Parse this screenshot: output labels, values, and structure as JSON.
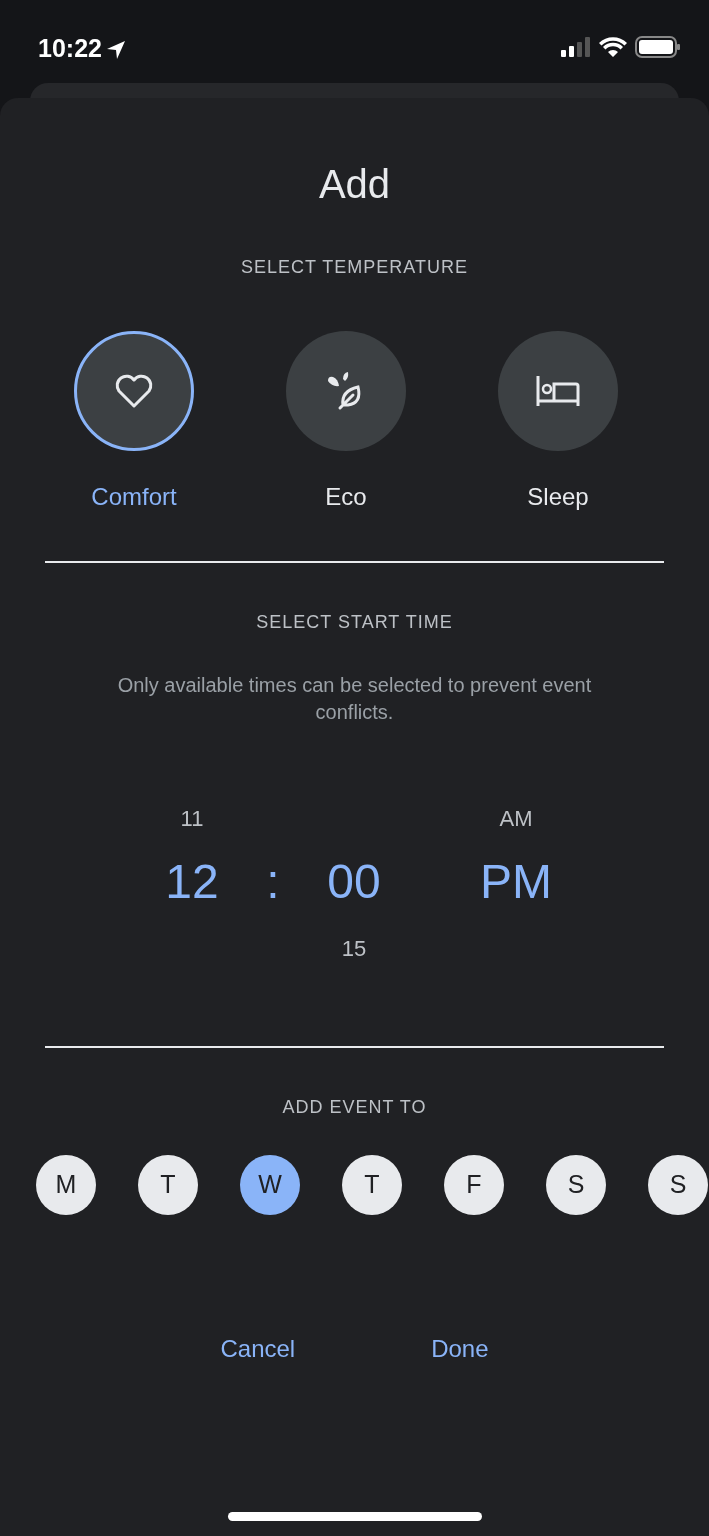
{
  "status_bar": {
    "time": "10:22"
  },
  "title": "Add",
  "temperature": {
    "heading": "SELECT TEMPERATURE",
    "options": [
      {
        "kind": "heart",
        "label": "Comfort",
        "selected": true
      },
      {
        "kind": "leaf",
        "label": "Eco",
        "selected": false
      },
      {
        "kind": "bed",
        "label": "Sleep",
        "selected": false
      }
    ]
  },
  "start_time": {
    "heading": "SELECT START TIME",
    "note": "Only available times can be selected to prevent event conflicts.",
    "columns": [
      {
        "kind": "hour",
        "above": "11",
        "value": "12"
      },
      {
        "kind": "separator",
        "value": ":"
      },
      {
        "kind": "minute",
        "value": "00",
        "below": "15"
      },
      {
        "kind": "period",
        "above": "AM",
        "value": "PM"
      }
    ]
  },
  "days": {
    "heading": "ADD EVENT TO",
    "items": [
      {
        "label": "M",
        "selected": false
      },
      {
        "label": "T",
        "selected": false
      },
      {
        "label": "W",
        "selected": true
      },
      {
        "label": "T",
        "selected": false
      },
      {
        "label": "F",
        "selected": false
      },
      {
        "label": "S",
        "selected": false
      },
      {
        "label": "S",
        "selected": false
      }
    ]
  },
  "buttons": [
    {
      "label": "Cancel"
    },
    {
      "label": "Done"
    }
  ]
}
